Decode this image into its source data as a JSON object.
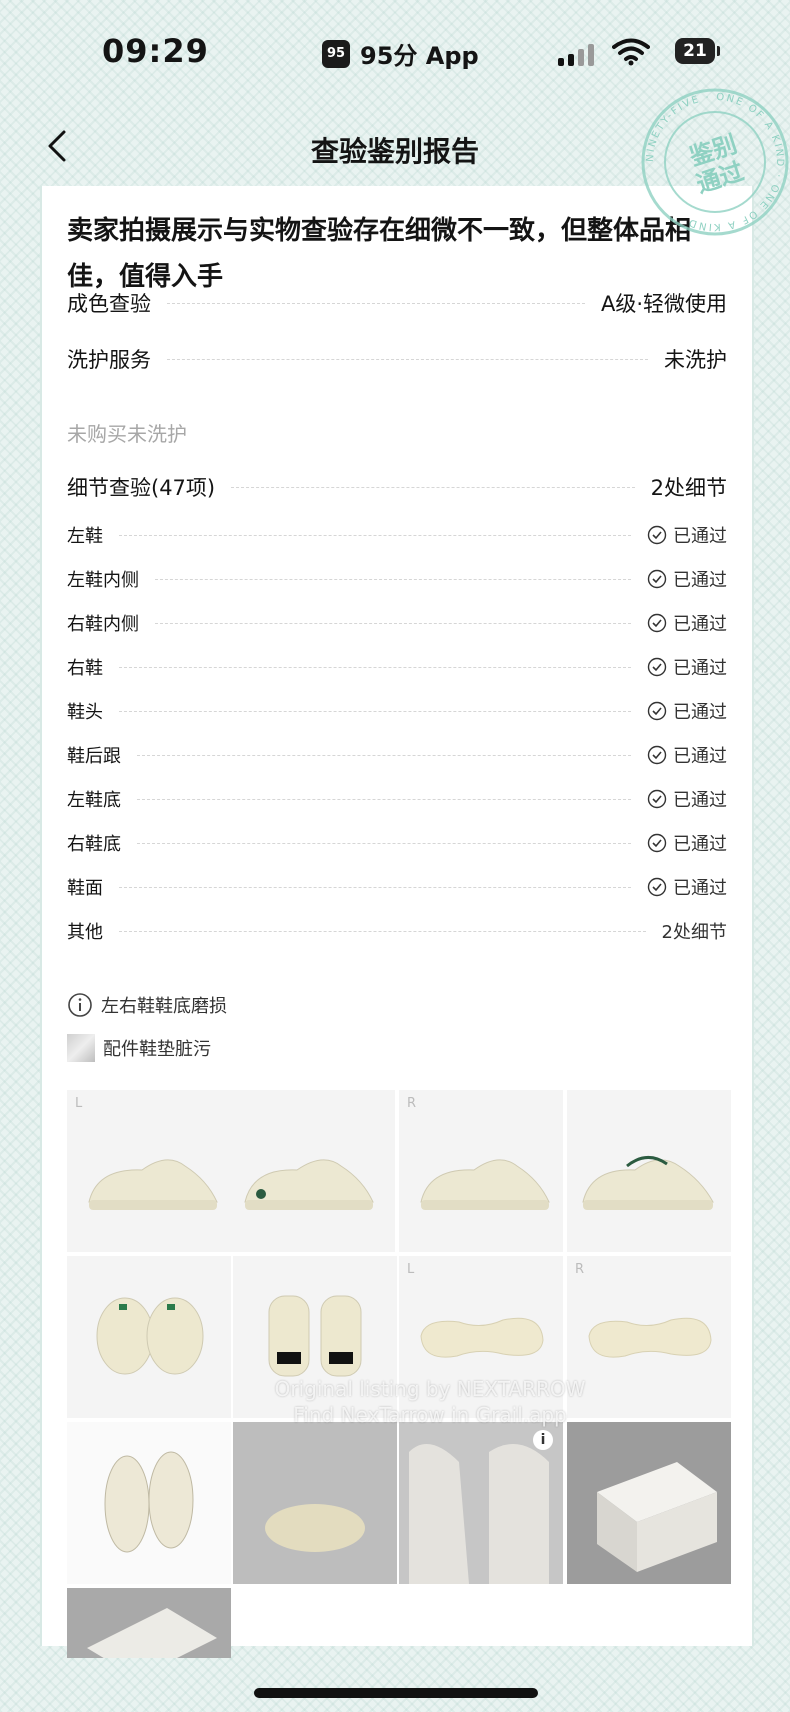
{
  "status_bar": {
    "time": "09:29",
    "carrier_logo": "95",
    "carrier": "95分 App",
    "battery": "21"
  },
  "nav": {
    "title": "查验鉴别报告"
  },
  "stamp": {
    "ring_text": "NINETY-FIVE · ONE OF A KIND · ONE OF A KIND",
    "line1": "鉴别",
    "line2": "通过"
  },
  "report": {
    "summary": "卖家拍摄展示与实物查验存在细微不一致，但整体品相佳，值得入手",
    "condition": {
      "label": "成色查验",
      "value": "A级·轻微使用"
    },
    "cleaning": {
      "label": "洗护服务",
      "value": "未洗护",
      "note": "未购买未洗护"
    },
    "details": {
      "label": "细节查验(47项)",
      "value": "2处细节"
    },
    "items": [
      {
        "label": "左鞋",
        "status": "已通过"
      },
      {
        "label": "左鞋内侧",
        "status": "已通过"
      },
      {
        "label": "右鞋内侧",
        "status": "已通过"
      },
      {
        "label": "右鞋",
        "status": "已通过"
      },
      {
        "label": "鞋头",
        "status": "已通过"
      },
      {
        "label": "鞋后跟",
        "status": "已通过"
      },
      {
        "label": "左鞋底",
        "status": "已通过"
      },
      {
        "label": "右鞋底",
        "status": "已通过"
      },
      {
        "label": "鞋面",
        "status": "已通过"
      },
      {
        "label": "其他",
        "status": "2处细节"
      }
    ],
    "issues": [
      {
        "icon": "info-circle-icon",
        "text": "左右鞋鞋底磨损"
      },
      {
        "icon": "photo-thumbnail-icon",
        "text": "配件鞋垫脏污"
      }
    ]
  },
  "gallery": {
    "tags": {
      "left": "L",
      "right": "R"
    },
    "watermark_line1": "Original listing by NEXTARROW",
    "watermark_line2": "Find NexTarrow in Grail.app",
    "info_badge": "i"
  },
  "colors": {
    "background": "#e9f3f1",
    "stamp": "#8fd1c2",
    "card": "#ffffff",
    "shoe": "#ece8d2"
  }
}
